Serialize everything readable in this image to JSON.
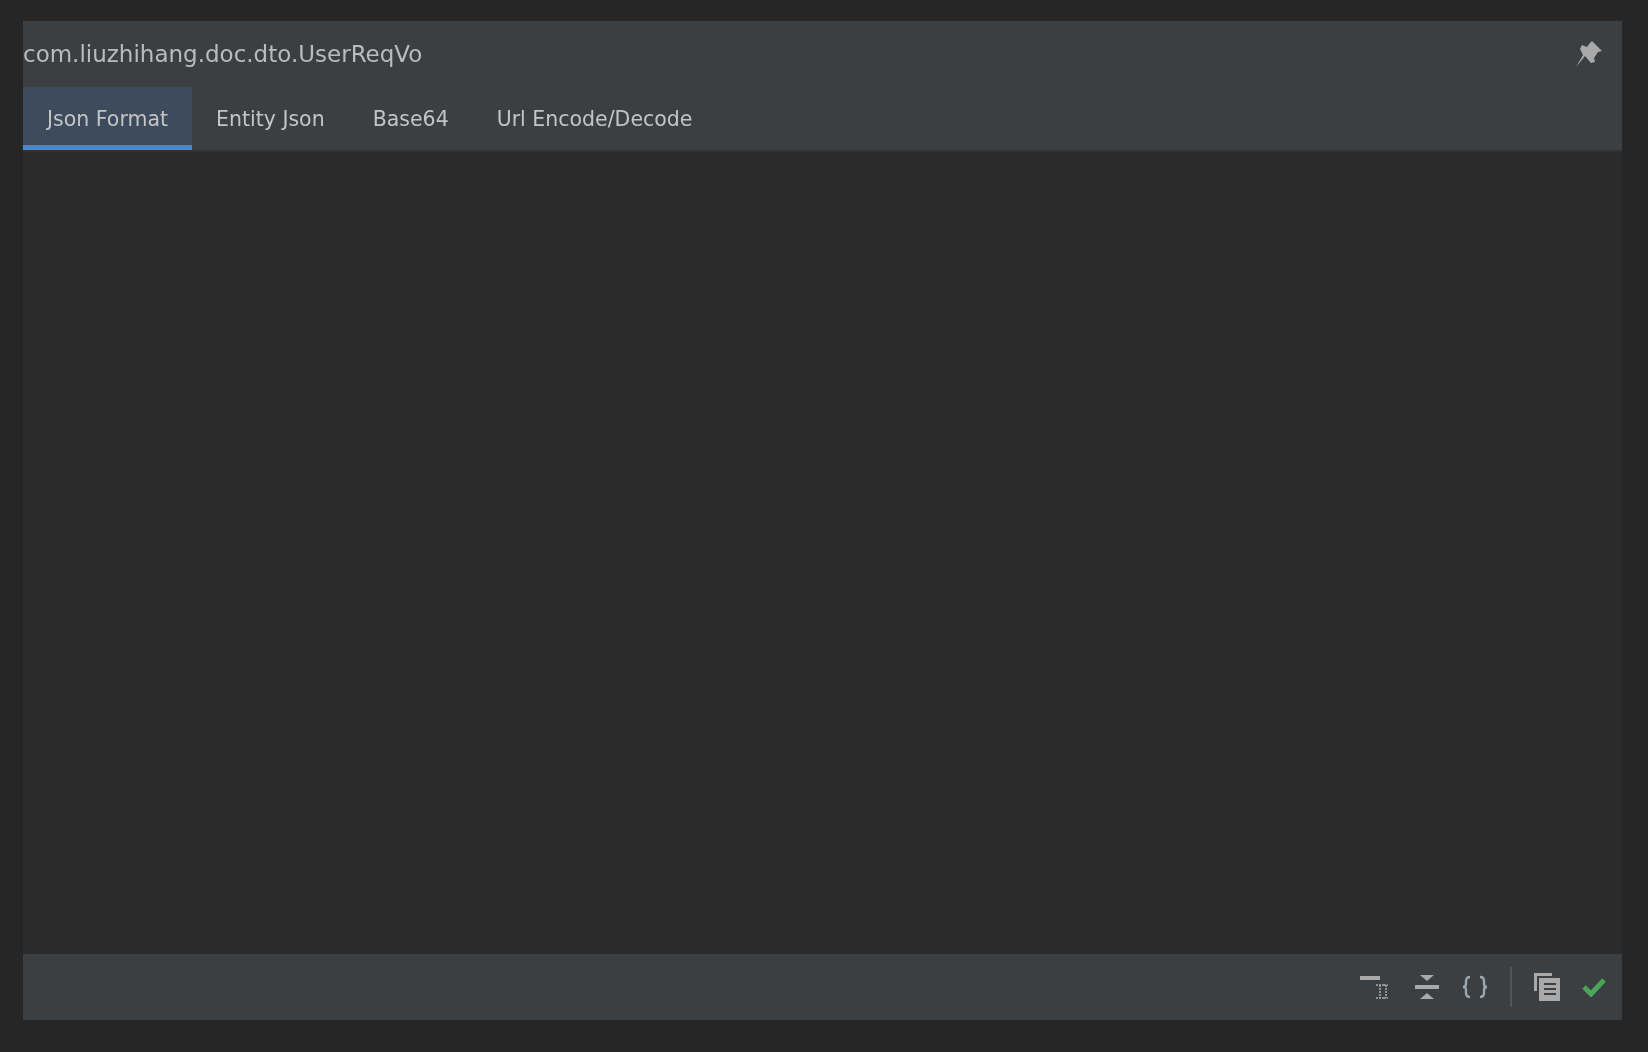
{
  "window": {
    "title": "com.liuzhihang.doc.dto.UserReqVo"
  },
  "tabs": [
    {
      "label": "Json Format",
      "selected": true
    },
    {
      "label": "Entity Json",
      "selected": false
    },
    {
      "label": "Base64",
      "selected": false
    },
    {
      "label": "Url Encode/Decode",
      "selected": false
    }
  ]
}
